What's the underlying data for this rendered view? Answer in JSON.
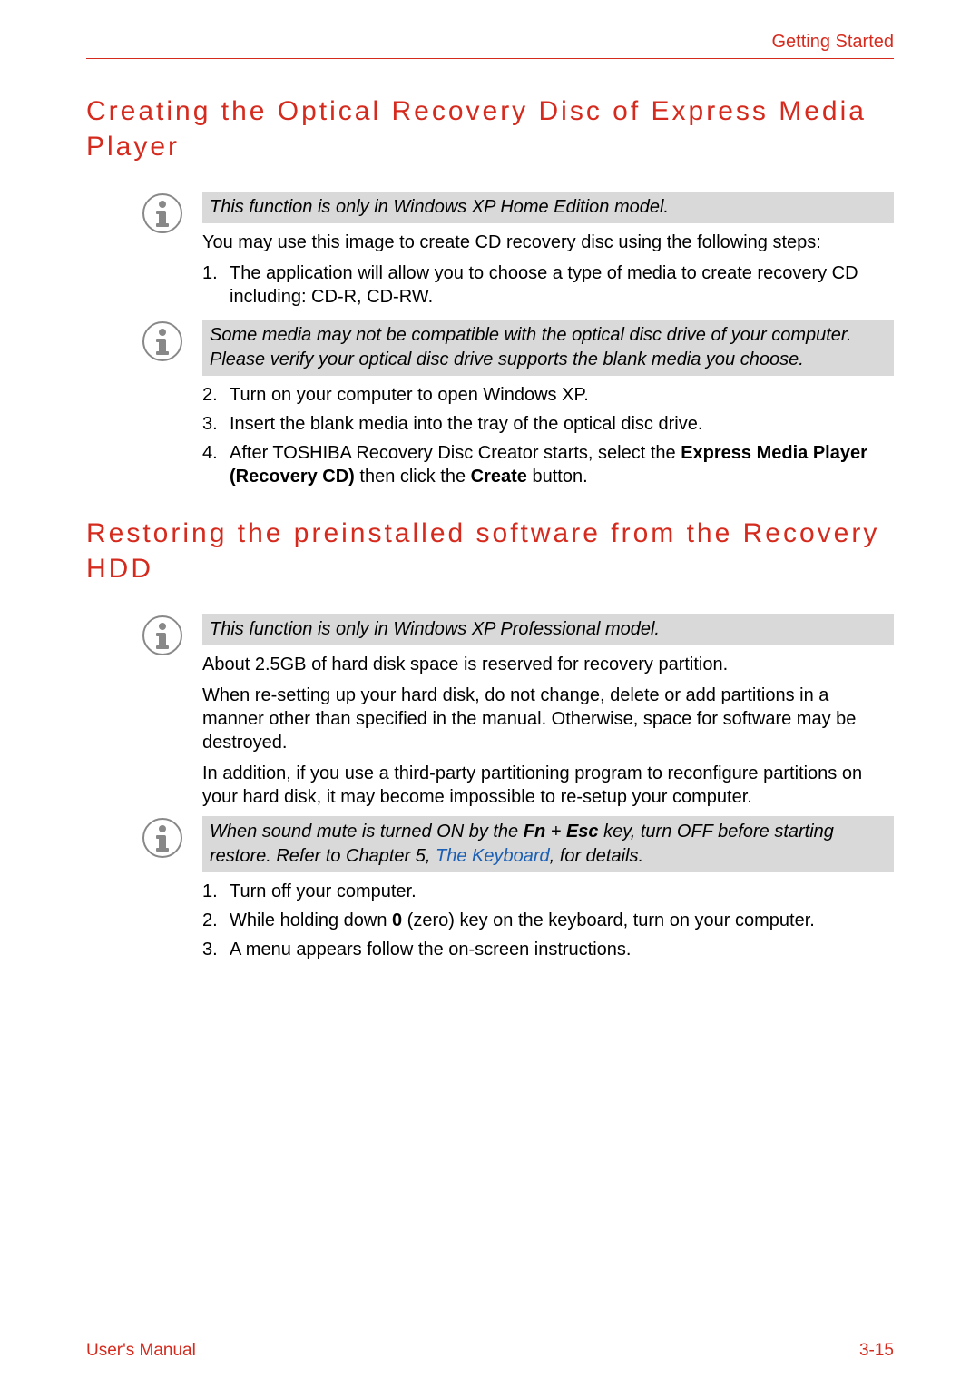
{
  "header": {
    "chapter": "Getting Started"
  },
  "section1": {
    "heading": "Creating the Optical Recovery Disc of Express Media Player",
    "note1": "This function is only in Windows XP Home Edition model.",
    "intro": "You may use this image to create CD recovery disc using the following steps:",
    "steps_a": {
      "n1": "1.",
      "t1": "The application will allow you to choose a type of media to create recovery CD including: CD-R, CD-RW."
    },
    "note2": "Some media may not be compatible with the optical disc drive of your computer. Please verify your optical disc drive supports the blank media you choose.",
    "steps_b": {
      "n2": "2.",
      "t2": "Turn on your computer to open Windows XP.",
      "n3": "3.",
      "t3": "Insert the blank media into the tray of the optical disc drive.",
      "n4": "4.",
      "t4a": "After TOSHIBA Recovery Disc Creator starts, select the ",
      "t4b": "Express Media Player (Recovery CD)",
      "t4c": " then click the ",
      "t4d": "Create",
      "t4e": " button."
    }
  },
  "section2": {
    "heading": "Restoring the preinstalled software from the Recovery HDD",
    "note1": "This function is only in Windows XP Professional model.",
    "p1": "About 2.5GB of hard disk space is reserved for recovery partition.",
    "p2": "When re-setting up your hard disk, do not change, delete or add partitions in a manner other than specified in the manual. Otherwise, space for software may be destroyed.",
    "p3": "In addition, if you use a third-party partitioning program to reconfigure partitions on your hard disk, it may become impossible to re-setup your computer.",
    "note2": {
      "a": "When sound mute is turned ON by the ",
      "b": "Fn",
      "c": " + ",
      "d": "Esc",
      "e": " key, turn OFF before starting restore. Refer to Chapter 5, ",
      "link": "The Keyboard",
      "f": ", for details."
    },
    "steps": {
      "n1": "1.",
      "t1": "Turn off your computer.",
      "n2": "2.",
      "t2a": "While holding down ",
      "t2b": "0",
      "t2c": " (zero) key on the keyboard, turn on your computer.",
      "n3": "3.",
      "t3": "A menu appears follow the on-screen instructions."
    }
  },
  "footer": {
    "left": "User's Manual",
    "right": "3-15"
  }
}
